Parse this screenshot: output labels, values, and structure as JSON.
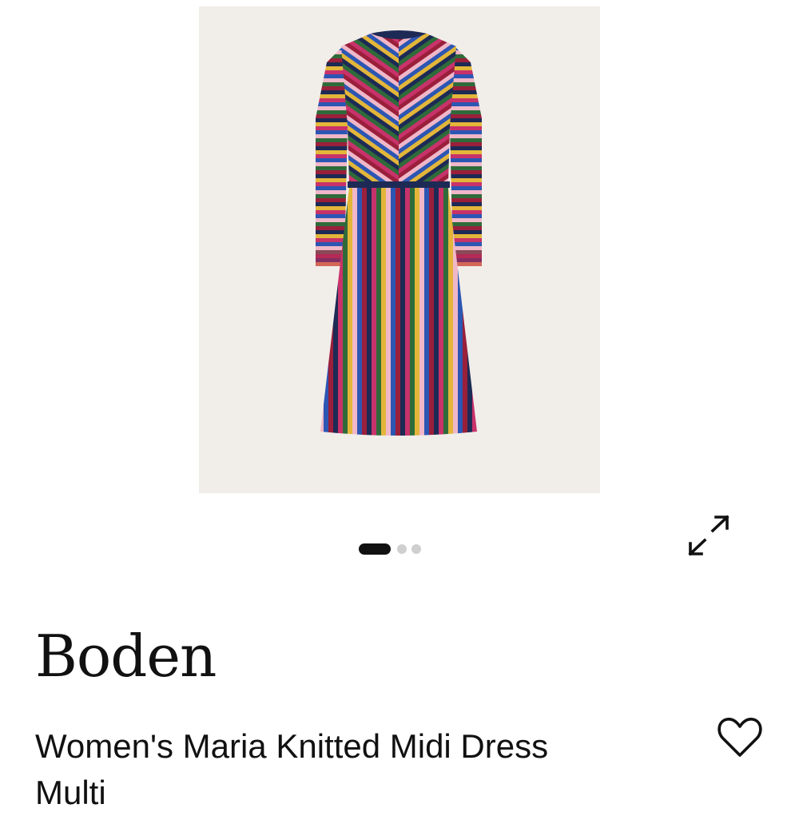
{
  "product": {
    "brand": "Boden",
    "title_line1": "Women's Maria Knitted Midi Dress",
    "title_line2": "Multi",
    "image_alt": "Women's Maria Knitted Midi Dress Multi"
  },
  "gallery": {
    "image_count": 3,
    "active_index": 0
  },
  "icons": {
    "expand": "expand-icon",
    "wishlist": "heart-outline-icon"
  },
  "colors": {
    "image_background": "#f1ede9",
    "text": "#111111",
    "dot_inactive": "#cfcfcf",
    "stripes": [
      "#1d2a55",
      "#c8326a",
      "#2f6b3a",
      "#e3b63a",
      "#f0b7c8",
      "#2c56b3",
      "#9a1f3b"
    ]
  }
}
